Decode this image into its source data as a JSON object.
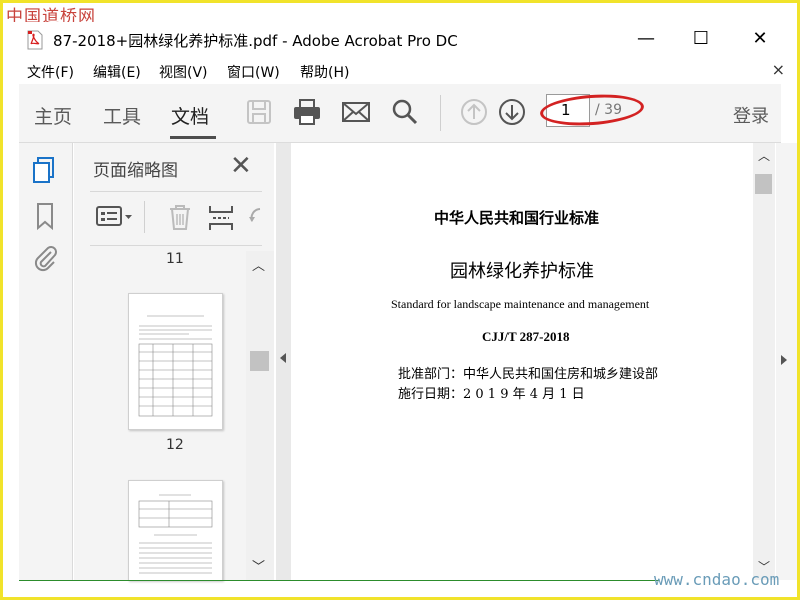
{
  "watermark": {
    "top": "中国道桥网",
    "bottom": "www.cndao.com"
  },
  "window": {
    "title": "87-2018+园林绿化养护标准.pdf - Adobe Acrobat Pro DC",
    "minimize": "—",
    "maximize": "☐",
    "close": "✕"
  },
  "menubar": {
    "items": [
      {
        "label": "文件(F)"
      },
      {
        "label": "编辑(E)"
      },
      {
        "label": "视图(V)"
      },
      {
        "label": "窗口(W)"
      },
      {
        "label": "帮助(H)"
      }
    ],
    "close": "×"
  },
  "toolbar": {
    "tabs": [
      {
        "label": "主页"
      },
      {
        "label": "工具"
      },
      {
        "label": "文档"
      }
    ],
    "active_tab": "文档",
    "icons": [
      "save-icon",
      "print-icon",
      "email-icon",
      "search-icon",
      "page-up-icon",
      "page-down-icon"
    ],
    "current_page": "1",
    "total_pages": "/ 39",
    "login": "登录"
  },
  "thumbnail_panel": {
    "title": "页面缩略图",
    "close": "✕",
    "page_labels": [
      "11",
      "12"
    ],
    "tools": [
      "options-menu-icon",
      "delete-icon",
      "page-insert-icon",
      "rotate-icon"
    ]
  },
  "document": {
    "header": "中华人民共和国行业标准",
    "title": "园林绿化养护标准",
    "english_title": "Standard for landscape maintenance and management",
    "code": "CJJ/T 287-2018",
    "approval": "批准部门：中华人民共和国住房和城乡建设部",
    "effective_date": "施行日期：2 0 1 9 年 4 月 1 日"
  },
  "colors": {
    "highlight_circle": "#d32222",
    "frame": "#f1e32a",
    "watermark_top": "#c8433c",
    "watermark_bottom": "#6a9cb8"
  }
}
